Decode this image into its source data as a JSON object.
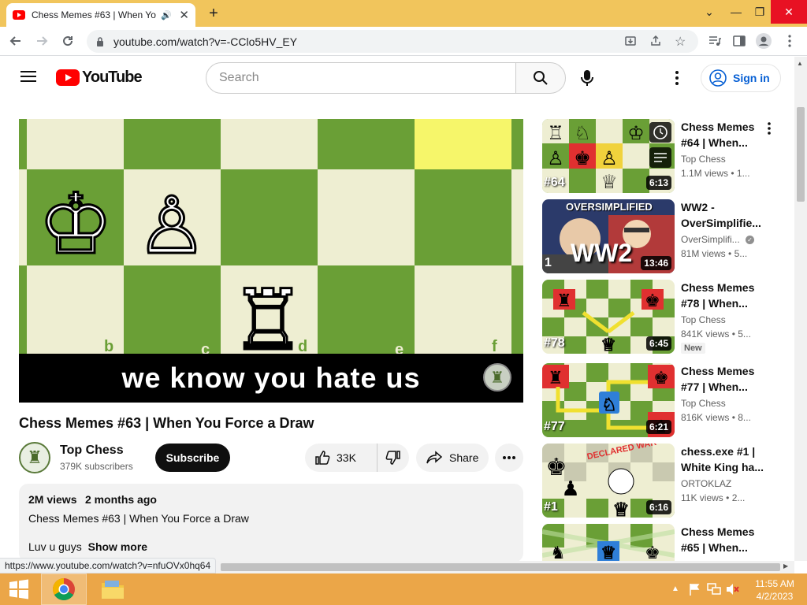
{
  "browser": {
    "tab_title": "Chess Memes #63 | When Yo",
    "url": "youtube.com/watch?v=-CClo5HV_EY",
    "status_url": "https://www.youtube.com/watch?v=nfuOVx0hq64"
  },
  "youtube": {
    "logo_text": "YouTube",
    "search_placeholder": "Search",
    "sign_in": "Sign in"
  },
  "video": {
    "board_files": [
      "b",
      "c",
      "d",
      "e",
      "f"
    ],
    "caption": "we know you hate us",
    "title": "Chess Memes #63 | When You Force a Draw",
    "channel": "Top Chess",
    "subscribers": "379K subscribers",
    "subscribe_label": "Subscribe",
    "likes": "33K",
    "share_label": "Share",
    "views": "2M views",
    "age": "2 months ago",
    "desc_line1": "Chess Memes #63 | When You Force a Draw",
    "desc_line2": "Luv u guys",
    "show_more": "Show more"
  },
  "recommendations": [
    {
      "title": "Chess Memes #64 | When...",
      "channel": "Top Chess",
      "views": "1.1M views",
      "age": "1...",
      "duration": "6:13",
      "num": "#64",
      "new": ""
    },
    {
      "title": "WW2 - OverSimplifie...",
      "channel": "OverSimplifi...",
      "views": "81M views",
      "age": "5...",
      "duration": "13:46",
      "num": "1",
      "new": "",
      "thumb_text": "OVERSIMPLIFIED",
      "thumb_big": "WW2"
    },
    {
      "title": "Chess Memes #78 | When...",
      "channel": "Top Chess",
      "views": "841K views",
      "age": "5...",
      "duration": "6:45",
      "num": "#78",
      "new": "New"
    },
    {
      "title": "Chess Memes #77 | When...",
      "channel": "Top Chess",
      "views": "816K views",
      "age": "8...",
      "duration": "6:21",
      "num": "#77",
      "new": ""
    },
    {
      "title": "chess.exe #1 | White King ha...",
      "channel": "ORTOKLAZ",
      "views": "11K views",
      "age": "2...",
      "duration": "6:16",
      "num": "#1",
      "new": "",
      "thumb_text": "DECLARED WAR"
    },
    {
      "title": "Chess Memes #65 | When...",
      "channel": "",
      "views": "",
      "age": "",
      "duration": "",
      "num": "",
      "new": ""
    }
  ],
  "taskbar": {
    "time": "11:55 AM",
    "date": "4/2/2023"
  },
  "colors": {
    "chrome_frame": "#f1c55c",
    "board_light": "#eeeed2",
    "board_dark": "#6a9f36",
    "youtube_red": "#ff0000",
    "taskbar": "#eba648"
  }
}
